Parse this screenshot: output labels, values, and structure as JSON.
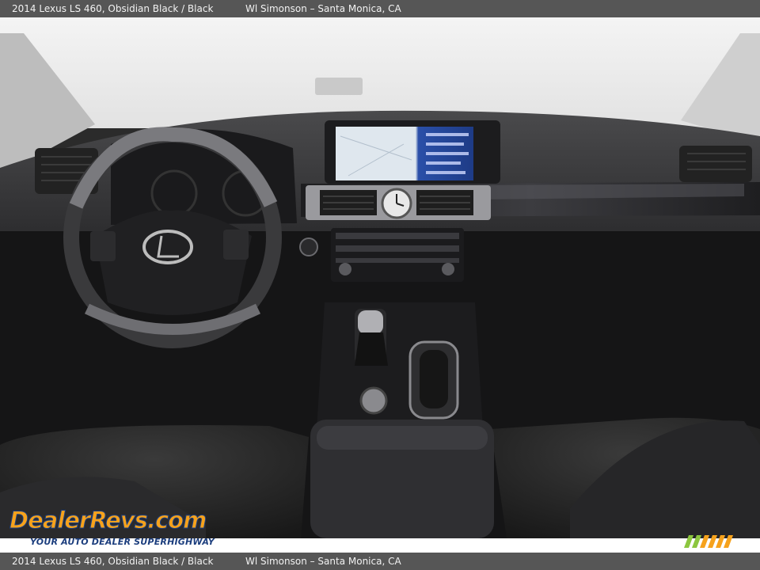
{
  "caption": {
    "vehicle": "2014 Lexus LS 460,  Obsidian Black / Black",
    "dealer": "Wl Simonson – Santa Monica, CA"
  },
  "watermark": {
    "logo_text": "DealerRevs.com",
    "tagline": "YOUR AUTO DEALER SUPERHIGHWAY"
  },
  "colors": {
    "caption_bar": "#565656",
    "logo_orange": "#f6a21c",
    "logo_blue": "#1b3d7d",
    "stripe_green": "#8cc63f",
    "stripe_orange": "#f6a21c"
  }
}
